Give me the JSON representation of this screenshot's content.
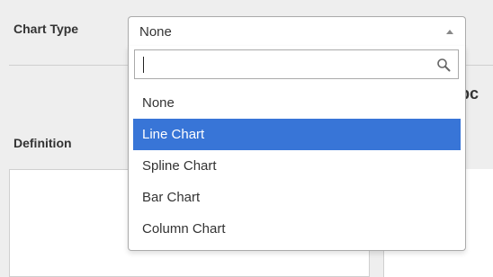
{
  "form": {
    "chart_type_label": "Chart Type",
    "definition_label": "Definition",
    "background_heading_partial": "ppc"
  },
  "select": {
    "current_value": "None",
    "search_value": "",
    "search_placeholder": "",
    "options": [
      {
        "label": "None",
        "selected": false
      },
      {
        "label": "Line Chart",
        "selected": true
      },
      {
        "label": "Spline Chart",
        "selected": false
      },
      {
        "label": "Bar Chart",
        "selected": false
      },
      {
        "label": "Column Chart",
        "selected": false
      }
    ],
    "highlight_color": "#3875d7"
  },
  "icons": {
    "dropdown_arrow": "triangle-up-icon",
    "search": "search-icon"
  }
}
